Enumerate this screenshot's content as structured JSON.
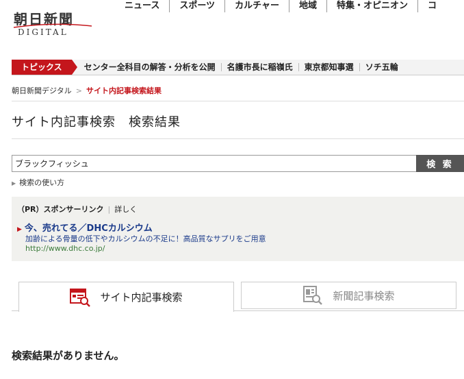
{
  "header": {
    "logo_title": "朝日新聞",
    "logo_sub": "DIGITAL",
    "nav": [
      "ニュース",
      "スポーツ",
      "カルチャー",
      "地域",
      "特集・オピニオン",
      "コ"
    ]
  },
  "topics": {
    "label": "トピックス",
    "items": [
      "センター全科目の解答・分析を公開",
      "名護市長に稲嶺氏",
      "東京都知事選",
      "ソチ五輪"
    ]
  },
  "breadcrumb": {
    "home": "朝日新聞デジタル",
    "separator": ">",
    "current": "サイト内記事検索結果"
  },
  "page_title": "サイト内記事検索　検索結果",
  "search": {
    "value": "ブラックフィッシュ",
    "button_label": "検 索",
    "howto_arrow": "▶",
    "howto_label": "検索の使い方"
  },
  "ad": {
    "pr_label": "（PR）スポンサーリンク",
    "sep": "|",
    "detail_link": "詳しく",
    "marker": "▶",
    "title": "今、売れてる／DHCカルシウム",
    "description": "加齢による骨量の低下やカルシウムの不足に！高品質なサプリをご用意",
    "url": "http://www.dhc.co.jp/"
  },
  "tabs": {
    "site": "サイト内記事検索",
    "paper": "新聞記事検索"
  },
  "result_message": "検索結果がありません。",
  "colors": {
    "accent_red": "#c4161c",
    "ad_link_blue": "#1a3a8a",
    "ad_url_green": "#3a7a3a",
    "button_gray": "#555555"
  }
}
